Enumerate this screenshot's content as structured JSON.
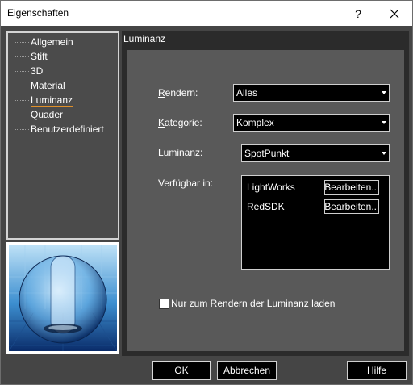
{
  "window": {
    "title": "Eigenschaften",
    "help_label": "?",
    "close_icon": "close-icon"
  },
  "tree": {
    "items": [
      {
        "label": "Allgemein"
      },
      {
        "label": "Stift"
      },
      {
        "label": "3D"
      },
      {
        "label": "Material"
      },
      {
        "label": "Luminanz",
        "selected": true
      },
      {
        "label": "Quader"
      },
      {
        "label": "Benutzerdefiniert"
      }
    ]
  },
  "section": {
    "title": "Luminanz"
  },
  "form": {
    "rendern": {
      "label_prefix": "R",
      "label_rest": "endern:",
      "value": "Alles"
    },
    "kategorie": {
      "label_prefix": "K",
      "label_rest": "ategorie:",
      "value": "Komplex"
    },
    "luminanz": {
      "label": "Luminanz:",
      "value": "SpotPunkt"
    },
    "verfuegbar": {
      "label": "Verfügbar in:",
      "rows": [
        {
          "name": "LightWorks",
          "button": "Bearbeiten.."
        },
        {
          "name": "RedSDK",
          "button": "Bearbeiten.."
        }
      ]
    },
    "checkbox": {
      "label_prefix": "N",
      "label_rest": "ur zum Rendern der Luminanz laden",
      "checked": false
    }
  },
  "footer": {
    "ok": "OK",
    "cancel": "Abbrechen",
    "help_prefix": "H",
    "help_rest": "ilfe"
  },
  "colors": {
    "accent_underline": "#e0902a",
    "panel_bg": "#595959",
    "dark_bg": "#2b2b2b"
  }
}
